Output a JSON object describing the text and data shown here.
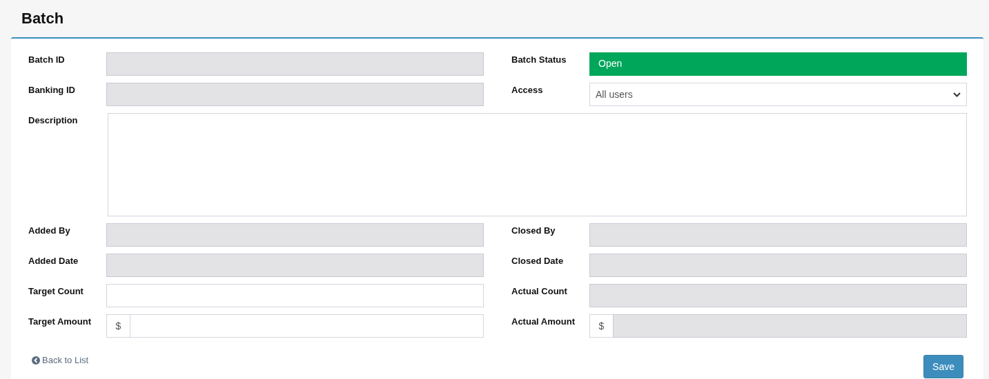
{
  "title": "Batch",
  "rows": [
    [
      {
        "label": "Batch ID",
        "kind": "text",
        "disabled": true
      },
      {
        "label": "Batch Status",
        "kind": "status",
        "value": "Open"
      }
    ],
    [
      {
        "label": "Banking ID",
        "kind": "text",
        "disabled": true
      },
      {
        "label": "Access",
        "kind": "select",
        "value": "All users"
      }
    ],
    [
      {
        "label": "Description",
        "kind": "textarea",
        "disabled": false
      }
    ],
    [
      {
        "label": "Added By",
        "kind": "text",
        "disabled": true
      },
      {
        "label": "Closed By",
        "kind": "text",
        "disabled": true
      }
    ],
    [
      {
        "label": "Added Date",
        "kind": "text",
        "disabled": true
      },
      {
        "label": "Closed Date",
        "kind": "text",
        "disabled": true
      }
    ],
    [
      {
        "label": "Target Count",
        "kind": "text",
        "disabled": false
      },
      {
        "label": "Actual Count",
        "kind": "text",
        "disabled": true
      }
    ],
    [
      {
        "label": "Target Amount",
        "kind": "amount",
        "prefix": "$",
        "disabled": false
      },
      {
        "label": "Actual Amount",
        "kind": "amount",
        "prefix": "$",
        "disabled": true
      }
    ]
  ],
  "back_link": "Back to List",
  "save_button": "Save"
}
